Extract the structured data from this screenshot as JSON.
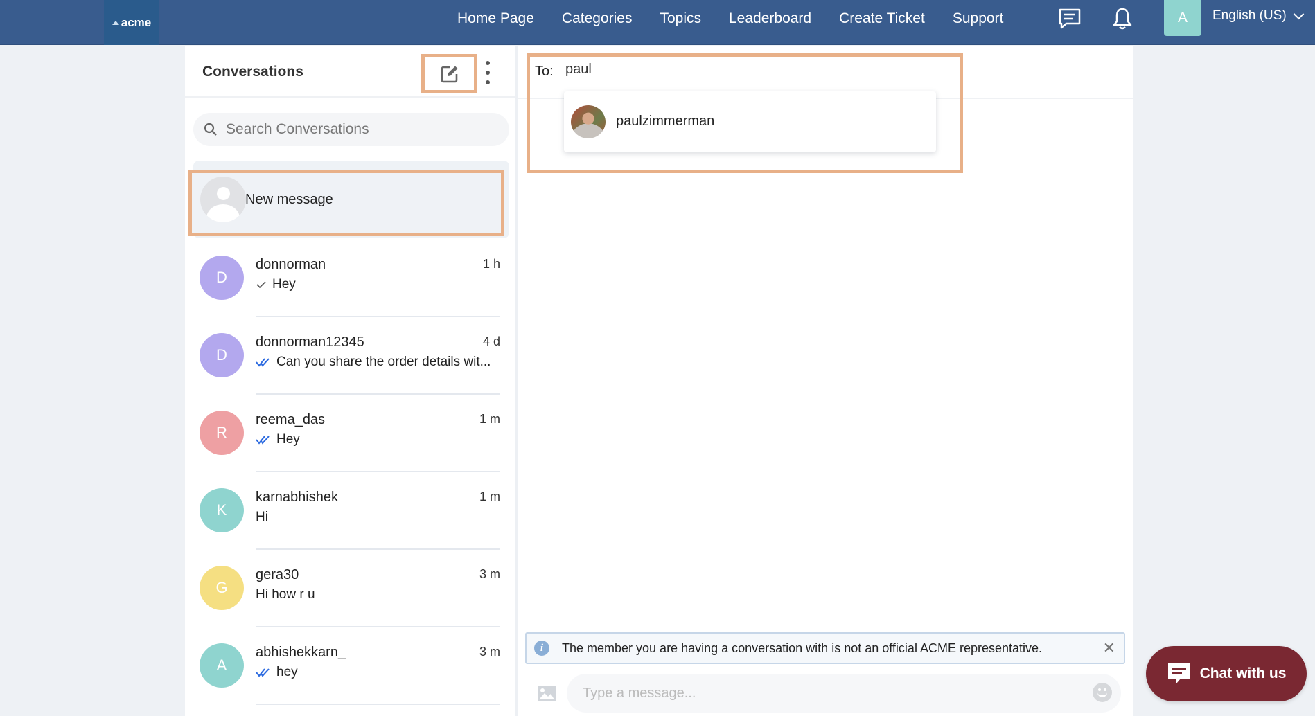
{
  "nav": {
    "logo": "acme",
    "links": [
      "Home Page",
      "Categories",
      "Topics",
      "Leaderboard",
      "Create Ticket",
      "Support"
    ],
    "user_initial": "A",
    "user_avatar_color": "#8fd4cf",
    "language": "English (US)",
    "bar_color": "#395c8e"
  },
  "conversations": {
    "title": "Conversations",
    "search_placeholder": "Search Conversations",
    "new_message_label": "New message",
    "items": [
      {
        "initial": "D",
        "color": "#b3a8ee",
        "name": "donnorman",
        "time": "1 h",
        "preview": "Hey",
        "status": "sent"
      },
      {
        "initial": "D",
        "color": "#b3a8ee",
        "name": "donnorman12345",
        "time": "4 d",
        "preview": "Can you share the order details wit...",
        "status": "read"
      },
      {
        "initial": "R",
        "color": "#eea0a3",
        "name": "reema_das",
        "time": "1 m",
        "preview": "Hey",
        "status": "read"
      },
      {
        "initial": "K",
        "color": "#8fd4cf",
        "name": "karnabhishek",
        "time": "1 m",
        "preview": "Hi",
        "status": "none"
      },
      {
        "initial": "G",
        "color": "#f5df82",
        "name": "gera30",
        "time": "3 m",
        "preview": "Hi how r u",
        "status": "none"
      },
      {
        "initial": "A",
        "color": "#8fd4cf",
        "name": "abhishekkarn_",
        "time": "3 m",
        "preview": "hey",
        "status": "read"
      }
    ]
  },
  "chat": {
    "to_label": "To:",
    "to_value": "paul",
    "suggestion": "paulzimmerman",
    "notice": "The member you are having a conversation with is not an official ACME representative.",
    "composer_placeholder": "Type a message..."
  },
  "chat_widget": {
    "label": "Chat with us",
    "color": "#7a2832"
  },
  "highlight_color": "#e8b088"
}
